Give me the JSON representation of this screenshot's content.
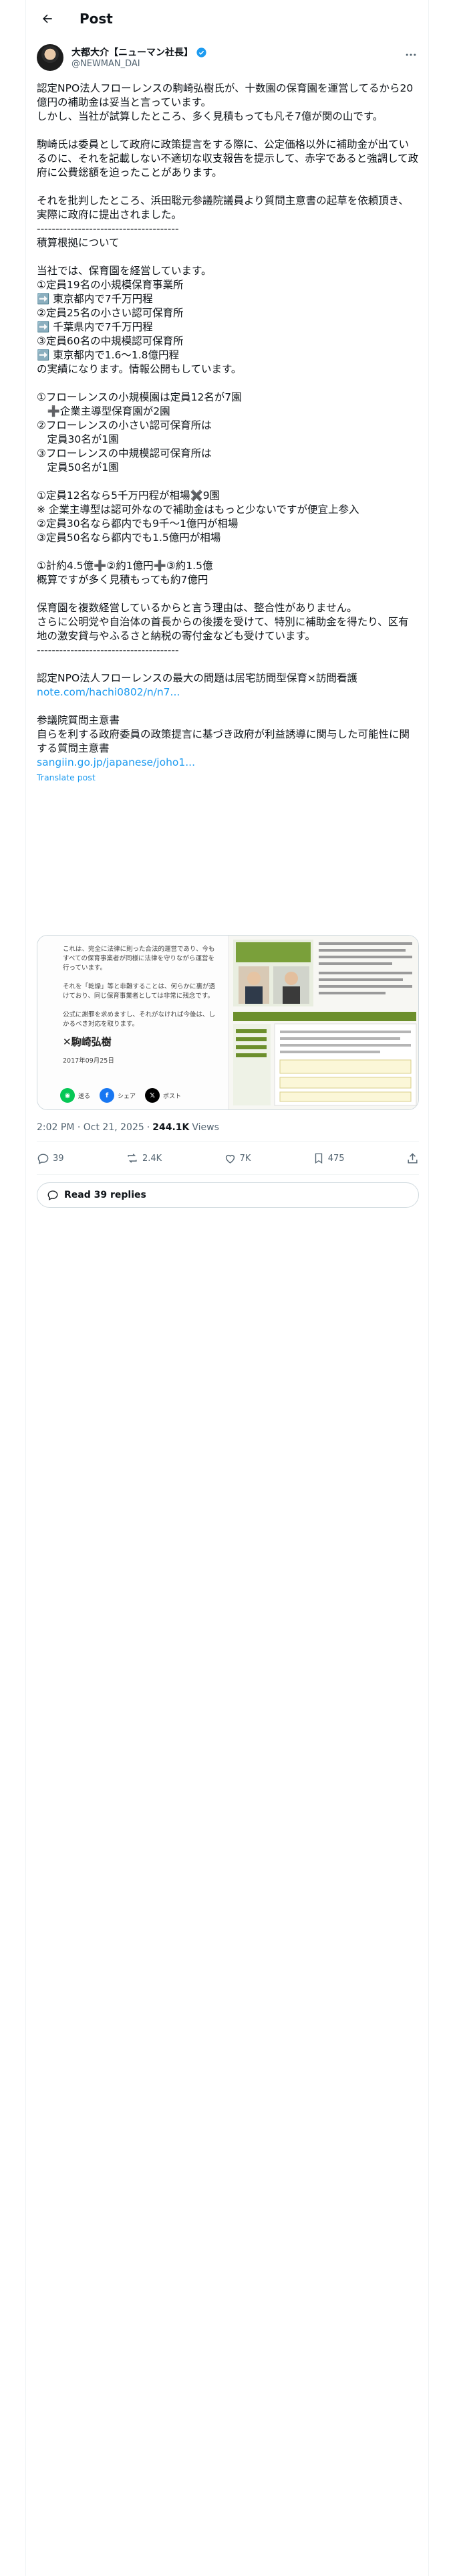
{
  "header": {
    "title": "Post"
  },
  "author": {
    "name": "大都大介【ニューマン社長】",
    "handle": "@NEWMAN_DAI"
  },
  "post": {
    "p1": "認定NPO法人フローレンスの駒崎弘樹氏が、十数園の保育園を運営してるから20億円の補助金は妥当と言っています。\nしかし、当社が試算したところ、多く見積もっても凡そ7億が関の山です。",
    "p2": "駒崎氏は委員として政府に政策提言をする際に、公定価格以外に補助金が出ているのに、それを記載しない不適切な収支報告を提示して、赤字であると強調して政府に公費総額を迫ったことがあります。",
    "p3": "それを批判したところ、浜田聡元参議院議員より質問主意書の起草を依頼頂き、実際に政府に提出されました。\n--------------------------------------\n積算根拠について",
    "p4": "当社では、保育園を経営しています。\n①定員19名の小規模保育事業所\n➡️ 東京都内で7千万円程\n②定員25名の小さい認可保育所\n➡️ 千葉県内で7千万円程\n③定員60名の中規模認可保育所\n➡️ 東京都内で1.6〜1.8億円程\nの実績になります。情報公開もしています。",
    "p5": "①フローレンスの小規模園は定員12名が7園\n　➕企業主導型保育園が2園\n②フローレンスの小さい認可保育所は\n　定員30名が1園\n③フローレンスの中規模認可保育所は\n　定員50名が1園",
    "p6": "①定員12名なら5千万円程が相場✖️9園\n※ 企業主導型は認可外なので補助金はもっと少ないですが便宜上参入\n②定員30名なら都内でも9千〜1億円が相場\n③定員50名なら都内でも1.5億円が相場",
    "p7": "①計約4.5億➕②約1億円➕③約1.5億\n概算ですが多く見積もっても約7億円",
    "p8": "保育園を複数経営しているからと言う理由は、整合性がありません。\nさらに公明党や自治体の首長からの後援を受けて、特別に補助金を得たり、区有地の激安貸与やふるさと納税の寄付金なども受けています。\n--------------------------------------",
    "p9": "認定NPO法人フローレンスの最大の問題は居宅訪問型保育×訪問看護",
    "link1": "note.com/hachi0802/n/n7...",
    "p10": "参議院質問主意書\n自らを利する政府委員の政策提言に基づき政府が利益誘導に関与した可能性に関する質問主意書",
    "link2": "sangiin.go.jp/japanese/joho1...",
    "translate": "Translate post"
  },
  "media": {
    "text": "これは、完全に法律に則った合法的運営であり、今もすべての保育事業者が同様に法律を守りながら運営を行っています。\n\nそれを「乾燥」等と非難することは、何らかに裏が透けており、同じ保育事業者としては非常に残念です。\n\n公式に謝罪を求めますし、それがなければ今後は、しかるべき対応を取ります。",
    "signature": "✕駒崎弘樹",
    "date": "2017年09月25日",
    "share": [
      "送る",
      "シェア",
      "ポスト"
    ]
  },
  "meta": {
    "time": "2:02 PM · Oct 21, 2025",
    "sep": "·",
    "views": "244.1K",
    "views_label": "Views"
  },
  "actions": {
    "replies": "39",
    "reposts": "2.4K",
    "likes": "7K",
    "bookmarks": "475"
  },
  "read_replies": "Read 39 replies",
  "colors": {
    "accent": "#1d9bf0",
    "muted": "#536471",
    "text": "#0f1419",
    "border": "#cfd9de"
  }
}
